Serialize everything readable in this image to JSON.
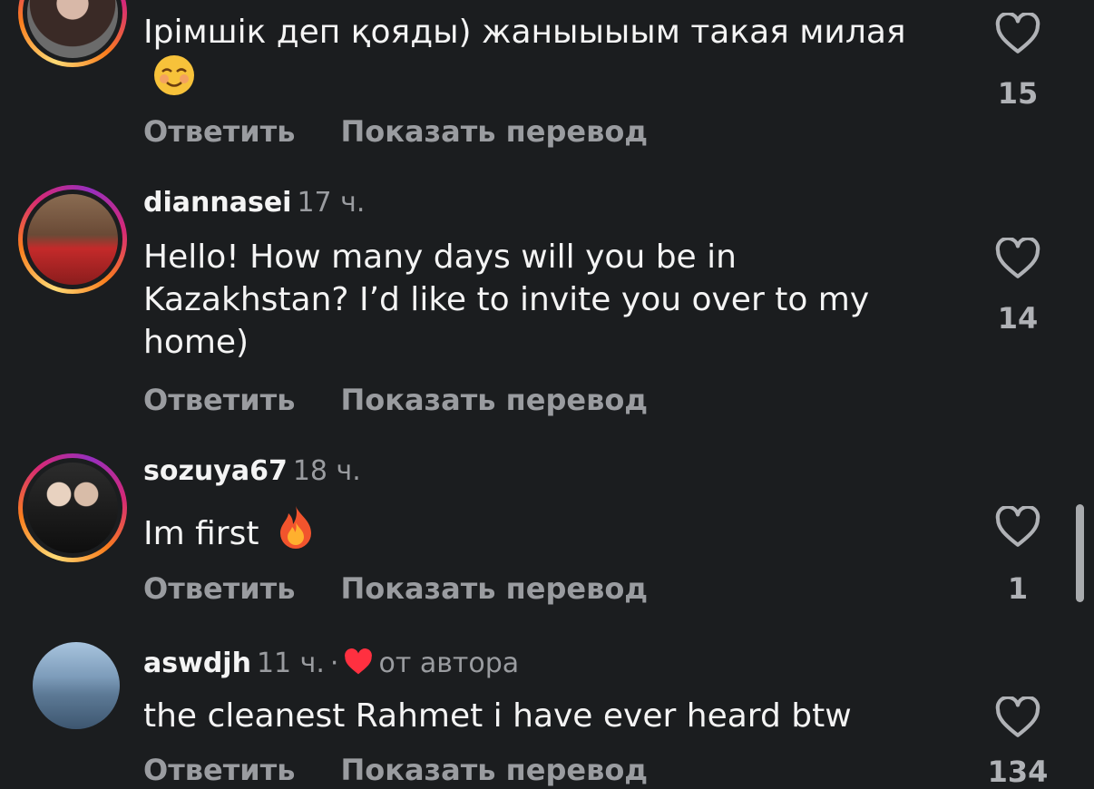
{
  "comments": [
    {
      "username": "",
      "time": "",
      "text": "Ірімшік деп қояды) жаныыыым такая милая",
      "emoji": "smiling-blush-emoji",
      "reply_label": "Ответить",
      "translate_label": "Показать перевод",
      "likes": "15"
    },
    {
      "username": "diannasei",
      "time": "17 ч.",
      "text": "Hello! How many days will you be in Kazakhstan? I’d like to invite you over to my home)",
      "reply_label": "Ответить",
      "translate_label": "Показать перевод",
      "likes": "14"
    },
    {
      "username": "sozuya67",
      "time": "18 ч.",
      "text": "Im first",
      "emoji": "fire-emoji",
      "reply_label": "Ответить",
      "translate_label": "Показать перевод",
      "likes": "1"
    },
    {
      "username": "aswdjh",
      "time": "11 ч.",
      "separator": "·",
      "author_like": "от автора",
      "text": "the cleanest Rahmet i have ever heard btw",
      "reply_label": "Ответить",
      "translate_label": "Показать перевод",
      "likes": "134"
    }
  ],
  "colors": {
    "background": "#1b1d1f",
    "text_primary": "#f4f4f4",
    "text_secondary": "#9a9ca0",
    "heart_red": "#ff3040"
  }
}
